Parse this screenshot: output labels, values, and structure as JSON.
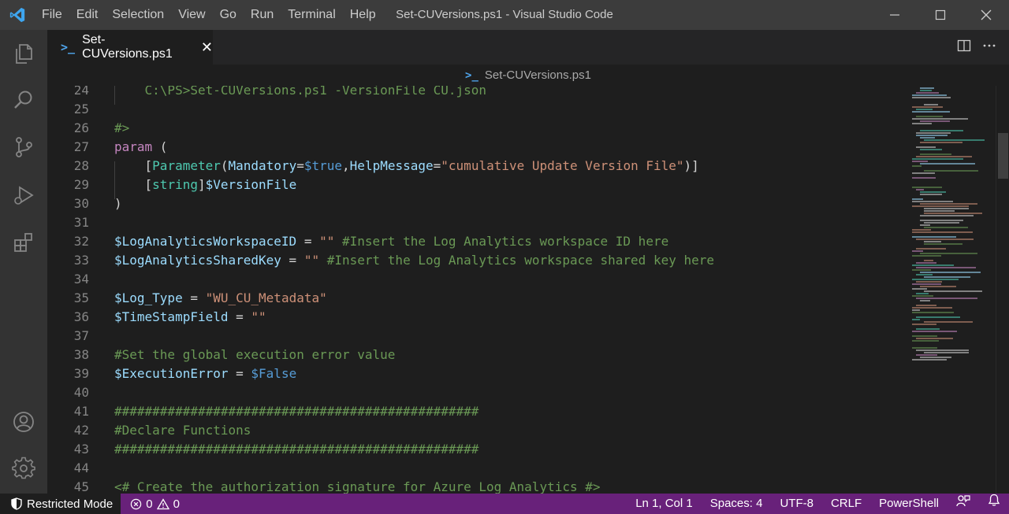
{
  "window": {
    "title": "Set-CUVersions.ps1 - Visual Studio Code",
    "menu": [
      "File",
      "Edit",
      "Selection",
      "View",
      "Go",
      "Run",
      "Terminal",
      "Help"
    ]
  },
  "tab": {
    "label": "Set-CUVersions.ps1",
    "icon": "powershell-icon"
  },
  "breadcrumb": {
    "label": "Set-CUVersions.ps1"
  },
  "editor": {
    "lines": [
      {
        "n": "24",
        "tokens": [
          [
            "c-com",
            "    C:\\PS>Set-CUVersions.ps1 -VersionFile CU.json"
          ]
        ]
      },
      {
        "n": "25",
        "tokens": []
      },
      {
        "n": "26",
        "tokens": [
          [
            "c-com",
            "#>"
          ]
        ]
      },
      {
        "n": "27",
        "tokens": [
          [
            "c-kw",
            "param"
          ],
          [
            "c-plain",
            " ("
          ]
        ]
      },
      {
        "n": "28",
        "tokens": [
          [
            "c-plain",
            "    ["
          ],
          [
            "c-type",
            "Parameter"
          ],
          [
            "c-plain",
            "("
          ],
          [
            "c-var",
            "Mandatory"
          ],
          [
            "c-plain",
            "="
          ],
          [
            "c-bool",
            "$true"
          ],
          [
            "c-plain",
            ","
          ],
          [
            "c-var",
            "HelpMessage"
          ],
          [
            "c-plain",
            "="
          ],
          [
            "c-str",
            "\"cumulative Update Version File\""
          ],
          [
            "c-plain",
            ")]"
          ]
        ]
      },
      {
        "n": "29",
        "tokens": [
          [
            "c-plain",
            "    ["
          ],
          [
            "c-type",
            "string"
          ],
          [
            "c-plain",
            "]"
          ],
          [
            "c-var",
            "$VersionFile"
          ]
        ]
      },
      {
        "n": "30",
        "tokens": [
          [
            "c-plain",
            ")"
          ]
        ]
      },
      {
        "n": "31",
        "tokens": []
      },
      {
        "n": "32",
        "tokens": [
          [
            "c-var",
            "$LogAnalyticsWorkspaceID"
          ],
          [
            "c-plain",
            " = "
          ],
          [
            "c-str",
            "\"\""
          ],
          [
            "c-plain",
            " "
          ],
          [
            "c-com",
            "#Insert the Log Analytics workspace ID here"
          ]
        ]
      },
      {
        "n": "33",
        "tokens": [
          [
            "c-var",
            "$LogAnalyticsSharedKey"
          ],
          [
            "c-plain",
            " = "
          ],
          [
            "c-str",
            "\"\""
          ],
          [
            "c-plain",
            " "
          ],
          [
            "c-com",
            "#Insert the Log Analytics workspace shared key here"
          ]
        ]
      },
      {
        "n": "34",
        "tokens": []
      },
      {
        "n": "35",
        "tokens": [
          [
            "c-var",
            "$Log_Type"
          ],
          [
            "c-plain",
            " = "
          ],
          [
            "c-str",
            "\"WU_CU_Metadata\""
          ]
        ]
      },
      {
        "n": "36",
        "tokens": [
          [
            "c-var",
            "$TimeStampField"
          ],
          [
            "c-plain",
            " = "
          ],
          [
            "c-str",
            "\"\""
          ]
        ]
      },
      {
        "n": "37",
        "tokens": []
      },
      {
        "n": "38",
        "tokens": [
          [
            "c-com",
            "#Set the global execution error value"
          ]
        ]
      },
      {
        "n": "39",
        "tokens": [
          [
            "c-var",
            "$ExecutionError"
          ],
          [
            "c-plain",
            " = "
          ],
          [
            "c-bool",
            "$False"
          ]
        ]
      },
      {
        "n": "40",
        "tokens": []
      },
      {
        "n": "41",
        "tokens": [
          [
            "c-com",
            "################################################"
          ]
        ]
      },
      {
        "n": "42",
        "tokens": [
          [
            "c-com",
            "#Declare Functions"
          ]
        ]
      },
      {
        "n": "43",
        "tokens": [
          [
            "c-com",
            "################################################"
          ]
        ]
      },
      {
        "n": "44",
        "tokens": []
      },
      {
        "n": "45",
        "tokens": [
          [
            "c-com",
            "<# Create the authorization signature for Azure Log Analytics #>"
          ]
        ]
      }
    ]
  },
  "statusbar": {
    "mode": "Restricted Mode",
    "errors": "0",
    "warnings": "0",
    "position": "Ln 1, Col 1",
    "spaces": "Spaces: 4",
    "encoding": "UTF-8",
    "eol": "CRLF",
    "language": "PowerShell"
  },
  "colors": {
    "statusbar": "#68217a",
    "accent": "#007acc",
    "comment": "#6a9955",
    "keyword": "#c586c0",
    "variable": "#9cdcfe",
    "string": "#ce9178"
  }
}
